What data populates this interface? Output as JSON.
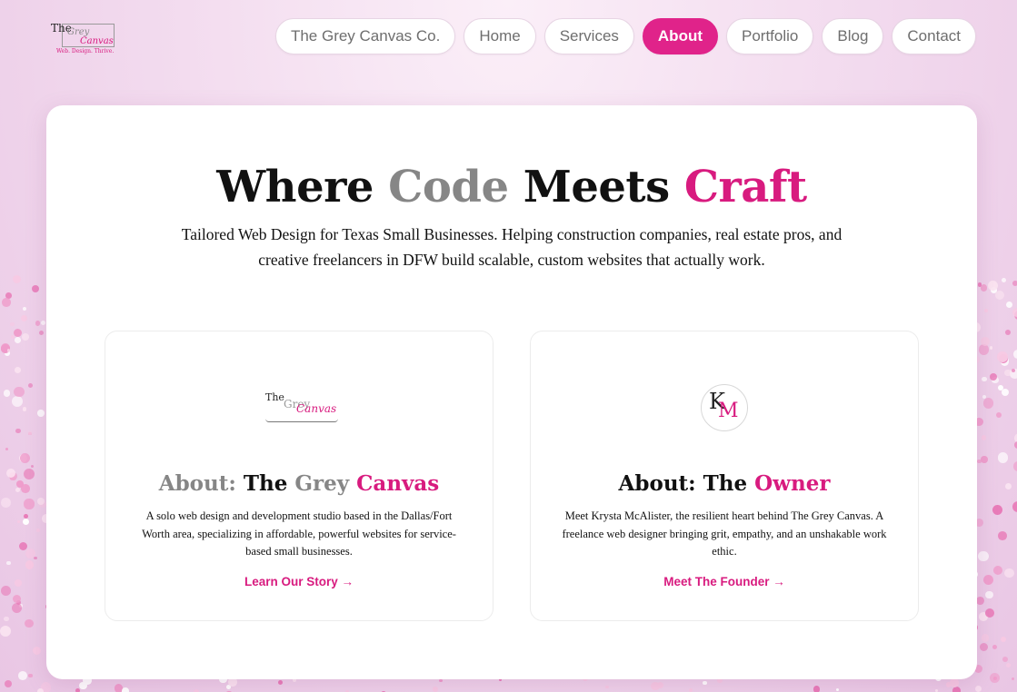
{
  "logo": {
    "line1": "The",
    "line2": "Grey",
    "line3": "Canvas",
    "tagline": "Web. Design. Thrive."
  },
  "nav": {
    "items": [
      {
        "label": "The Grey Canvas Co."
      },
      {
        "label": "Home"
      },
      {
        "label": "Services"
      },
      {
        "label": "About"
      },
      {
        "label": "Portfolio"
      },
      {
        "label": "Blog"
      },
      {
        "label": "Contact"
      }
    ],
    "active": "About"
  },
  "hero": {
    "title_parts": [
      "Where ",
      "Code",
      " Meets ",
      "Craft"
    ],
    "subtitle": "Tailored Web Design for Texas Small Businesses. Helping construction companies, real estate pros, and creative freelancers in DFW build scalable, custom websites that actually work."
  },
  "cards": [
    {
      "title_parts": [
        "About: ",
        "The ",
        "Grey ",
        "Canvas"
      ],
      "description": "A solo web design and development studio based in the Dallas/Fort Worth area, specializing in affordable, powerful websites for service-based small businesses.",
      "link": "Learn Our Story →",
      "logo": {
        "the": "The",
        "grey": "Grey",
        "canvas": "Canvas"
      }
    },
    {
      "title_parts": [
        "About: The ",
        "Owner"
      ],
      "description": "Meet Krysta McAlister, the resilient heart behind The Grey Canvas. A freelance web designer bringing grit, empathy, and an unshakable work ethic.",
      "link": "Meet The Founder →",
      "logo": {
        "k": "K",
        "m": "M"
      }
    }
  ],
  "colors": {
    "accent": "#d81b7f",
    "active_nav": "#e0238a",
    "grey_text": "#868686"
  }
}
